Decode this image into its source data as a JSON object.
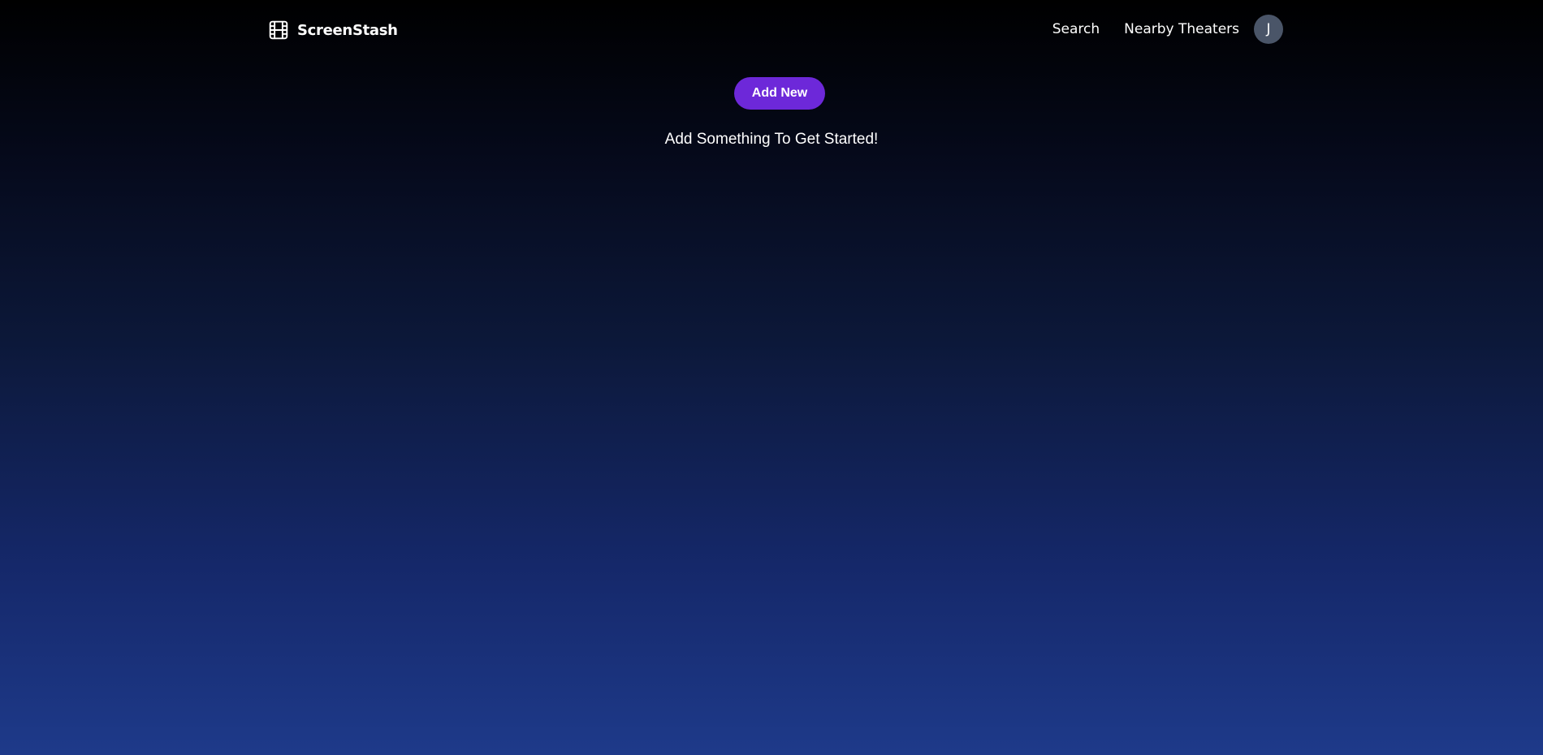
{
  "header": {
    "brand": {
      "name": "ScreenStash",
      "icon": "film-icon"
    },
    "nav_links": [
      {
        "label": "Search"
      },
      {
        "label": "Nearby Theaters"
      }
    ],
    "avatar_initial": "J"
  },
  "main": {
    "add_button_label": "Add New",
    "empty_message": "Add Something To Get Started!"
  },
  "colors": {
    "accent": "#6d28d9",
    "avatar_bg": "#4a5568",
    "gradient_top": "#000000",
    "gradient_bottom": "#1e3a8a"
  }
}
